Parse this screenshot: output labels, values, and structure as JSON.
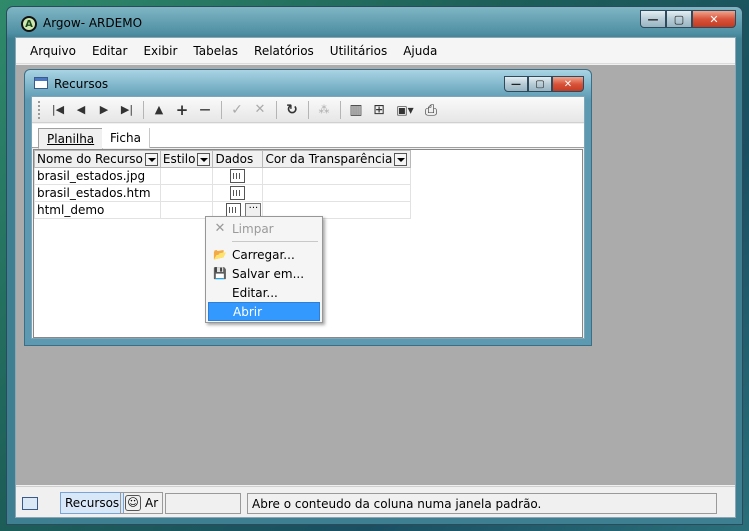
{
  "app": {
    "title": "Argow- ARDEMO",
    "icon": "app-logo-icon"
  },
  "main_controls": {
    "minimize": "—",
    "maximize": "▢",
    "close": "✕"
  },
  "menubar": [
    {
      "label": "Arquivo"
    },
    {
      "label": "Editar"
    },
    {
      "label": "Exibir"
    },
    {
      "label": "Tabelas"
    },
    {
      "label": "Relatórios"
    },
    {
      "label": "Utilitários"
    },
    {
      "label": "Ajuda"
    }
  ],
  "child_window": {
    "title": "Recursos",
    "controls": {
      "minimize": "—",
      "maximize": "▢",
      "close": "✕"
    }
  },
  "toolbar": {
    "icons": [
      "first-record-icon",
      "prev-record-icon",
      "next-record-icon",
      "last-record-icon",
      "move-up-icon",
      "add-icon",
      "remove-icon",
      "confirm-icon",
      "cancel-icon",
      "refresh-icon",
      "filter-icon",
      "grid-columns-icon",
      "find-icon",
      "export-icon",
      "print-icon"
    ],
    "glyphs": {
      "first": "|◀",
      "prev": "◀",
      "next": "▶",
      "last": "▶|",
      "up": "▲",
      "add": "+",
      "remove": "—",
      "confirm": "✓",
      "cancel": "✕",
      "refresh": "↻",
      "filter": "⁂",
      "columns": "▥",
      "find": "⊞",
      "export": "▣▾",
      "print": "⎙"
    }
  },
  "tabs": [
    {
      "label": "Planilha",
      "active": true
    },
    {
      "label": "Ficha",
      "active": false
    }
  ],
  "grid": {
    "columns": [
      "Nome do Recurso",
      "Estilo",
      "Dados",
      "Cor da Transparência"
    ],
    "rows": [
      {
        "name": "brasil_estados.jpg",
        "estilo": "",
        "cor": ""
      },
      {
        "name": "brasil_estados.htm",
        "estilo": "",
        "cor": ""
      },
      {
        "name": "html_demo",
        "estilo": "",
        "cor": ""
      }
    ],
    "ellipsis": "···"
  },
  "context_menu": {
    "items": [
      {
        "label": "Limpar",
        "icon": "clear-icon",
        "glyph": "✕",
        "disabled": true
      },
      {
        "label": "Carregar...",
        "icon": "open-folder-icon",
        "glyph": "📂",
        "disabled": false
      },
      {
        "label": "Salvar em...",
        "icon": "save-disk-icon",
        "glyph": "💾",
        "disabled": false
      },
      {
        "label": "Editar...",
        "icon": "",
        "glyph": "",
        "disabled": false
      },
      {
        "label": "Abrir",
        "icon": "",
        "glyph": "",
        "disabled": false,
        "selected": true
      }
    ]
  },
  "statusbar": {
    "task_active": "Recursos",
    "task_other": "Ar",
    "message": "Abre o conteudo da coluna numa janela padrão."
  },
  "colors": {
    "accent_selected": "#3399ff",
    "close_button": "#c23a22",
    "mdi_background": "#ababab"
  }
}
